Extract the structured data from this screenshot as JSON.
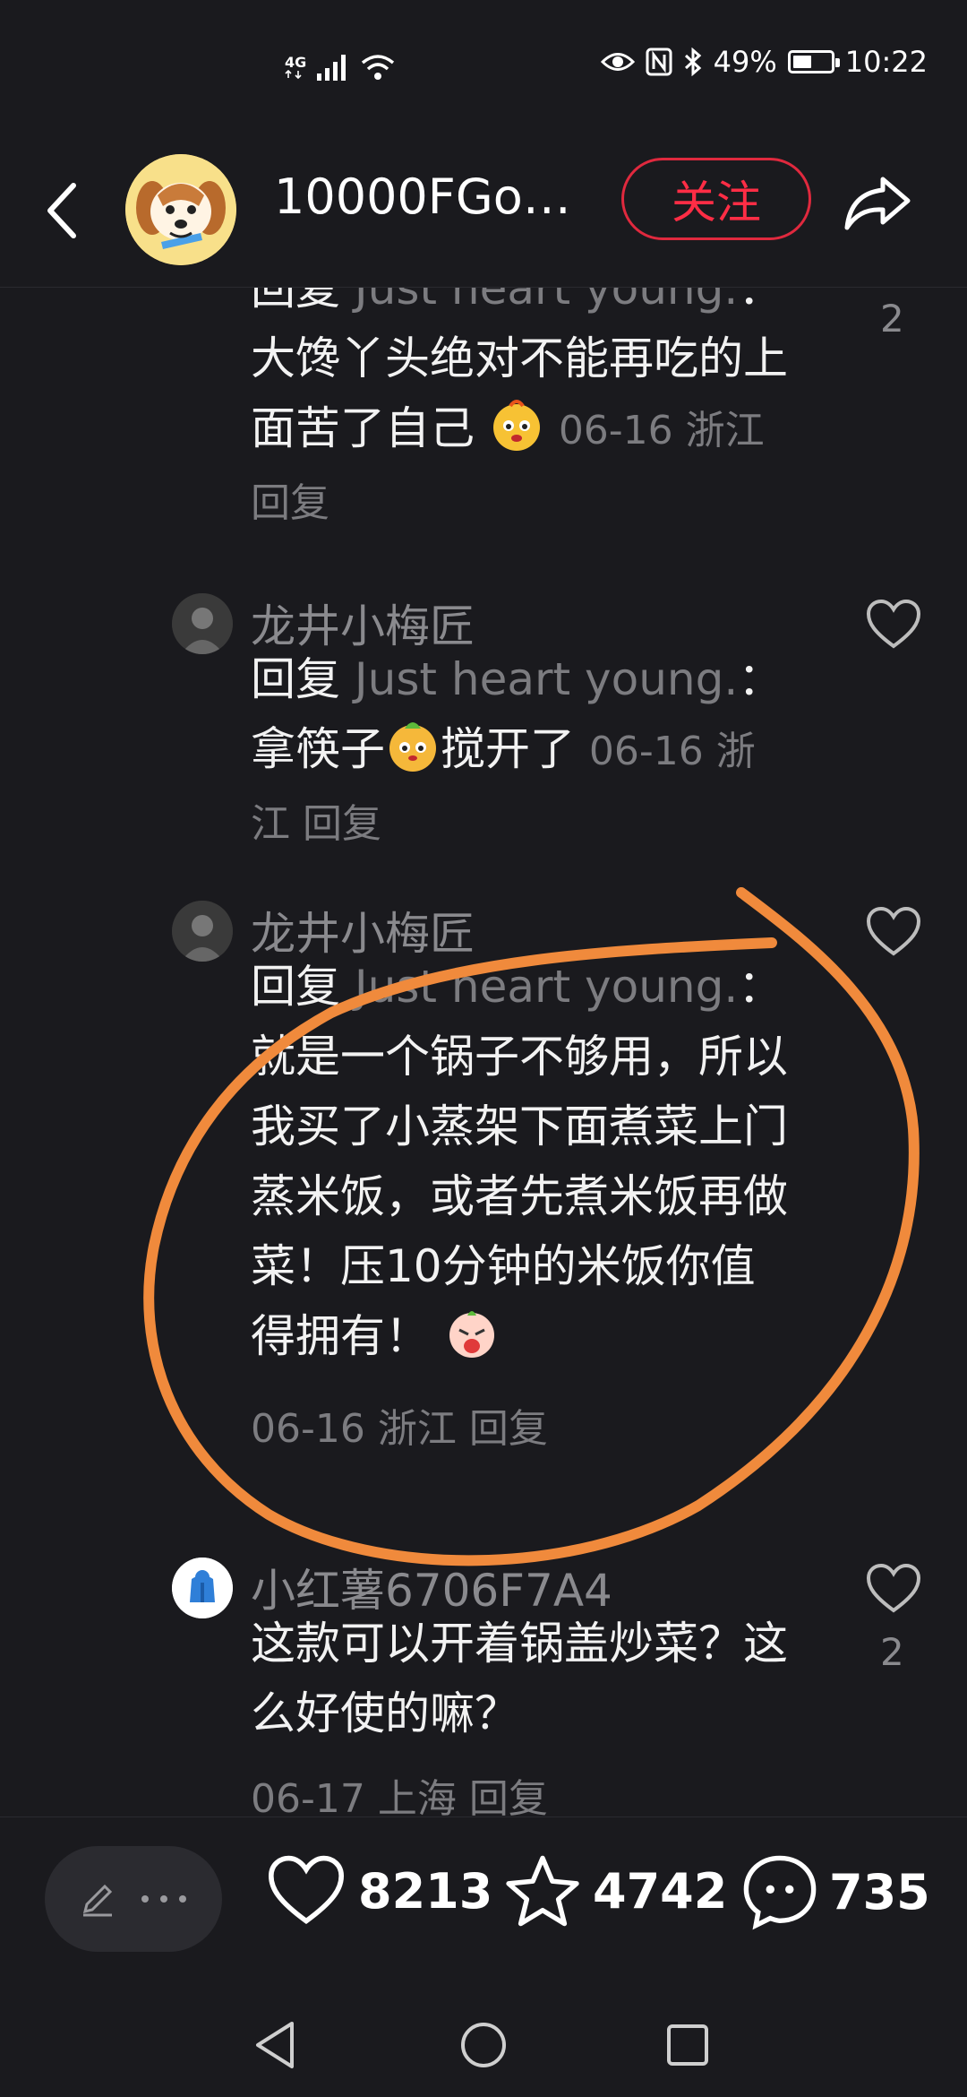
{
  "status_bar": {
    "network": "4G",
    "battery": "49%",
    "battery_level": 0.49,
    "time": "10:22"
  },
  "header": {
    "author": "10000FGo…",
    "follow_label": "关注"
  },
  "comments": [
    {
      "reply_prefix": "回复",
      "reply_to": "Just heart young.",
      "colon": "：",
      "text_a": "大馋丫头绝对不能再吃的上面苦了自己",
      "text_b": "",
      "date": "06-16",
      "location": "浙江",
      "reply_label": "回复",
      "likes": "2"
    },
    {
      "user": "龙井小梅匠",
      "reply_prefix": "回复",
      "reply_to": "Just heart young.",
      "colon": "：",
      "text_a": "拿筷子",
      "text_b": "搅开了",
      "date": "06-16",
      "location": "浙江",
      "reply_label": "回复"
    },
    {
      "user": "龙井小梅匠",
      "reply_prefix": "回复",
      "reply_to": "Just heart young.",
      "colon": "：",
      "text_a": "就是一个锅子不够用，所以我买了小蒸架下面煮菜上门蒸米饭，或者先煮米饭再做菜！压10分钟的米饭你值得拥有！",
      "text_b": "",
      "date": "06-16",
      "location": "浙江",
      "reply_label": "回复"
    },
    {
      "user": "小红薯6706F7A4",
      "text_a": "这款可以开着锅盖炒菜？这么好使的嘛？",
      "date": "06-17",
      "location": "上海",
      "reply_label": "回复",
      "likes": "2"
    }
  ],
  "bottom_bar": {
    "likes": "8213",
    "favorites": "4742",
    "comments": "735"
  },
  "colors": {
    "background": "#1a1a1e",
    "follow": "#ff2d45",
    "annotation": "#f08a3c"
  }
}
